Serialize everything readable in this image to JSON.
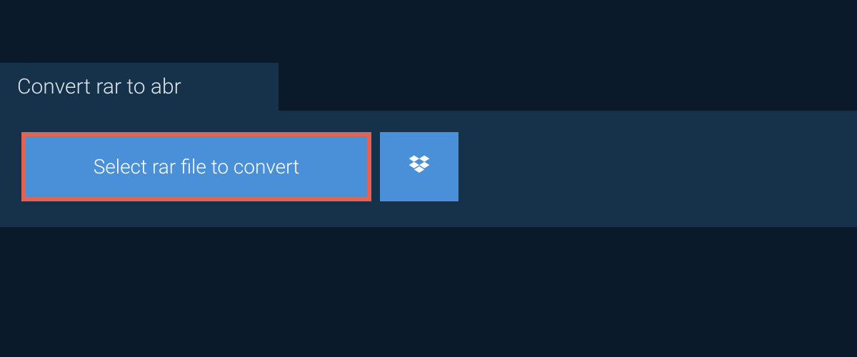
{
  "tab": {
    "title": "Convert rar to abr"
  },
  "buttons": {
    "select_file_label": "Select rar file to convert"
  }
}
